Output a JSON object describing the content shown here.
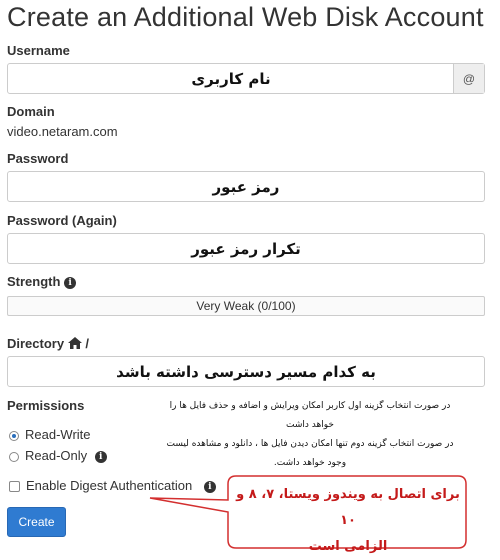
{
  "page": {
    "title": "Create an Additional Web Disk Account"
  },
  "username": {
    "label": "Username",
    "value": "نام کاربری",
    "addon": "@"
  },
  "domain": {
    "label": "Domain",
    "value": "video.netaram.com"
  },
  "password": {
    "label": "Password",
    "value": "رمز عبور"
  },
  "password_again": {
    "label": "Password (Again)",
    "value": "تکرار رمز عبور"
  },
  "strength": {
    "label": "Strength",
    "meter_text": "Very Weak (0/100)"
  },
  "directory": {
    "label": "Directory",
    "separator": "/",
    "value": "به کدام مسیر دسترسی داشته باشد"
  },
  "permissions": {
    "label": "Permissions",
    "options": [
      {
        "label": "Read-Write",
        "selected": true
      },
      {
        "label": "Read-Only",
        "selected": false
      }
    ],
    "note_lines": [
      "در صورت انتخاب گزینه اول کاربر امکان ویرایش و اضافه و حذف فایل ها را",
      "خواهد داشت",
      "در صورت انتخاب گزینه دوم تنها امکان دیدن فایل ها ، دانلود و مشاهده لیست",
      "وجود خواهد داشت."
    ]
  },
  "digest": {
    "label": "Enable Digest Authentication",
    "checked": false
  },
  "create_button": {
    "label": "Create"
  },
  "callout": {
    "lines": [
      "برای اتصال به ویندوز ویستا، ۷، ۸ و ۱۰",
      "الزامی است"
    ],
    "border_color": "#d32f2f"
  },
  "colors": {
    "accent": "#2f7bd1",
    "info_icon": "#333333"
  }
}
